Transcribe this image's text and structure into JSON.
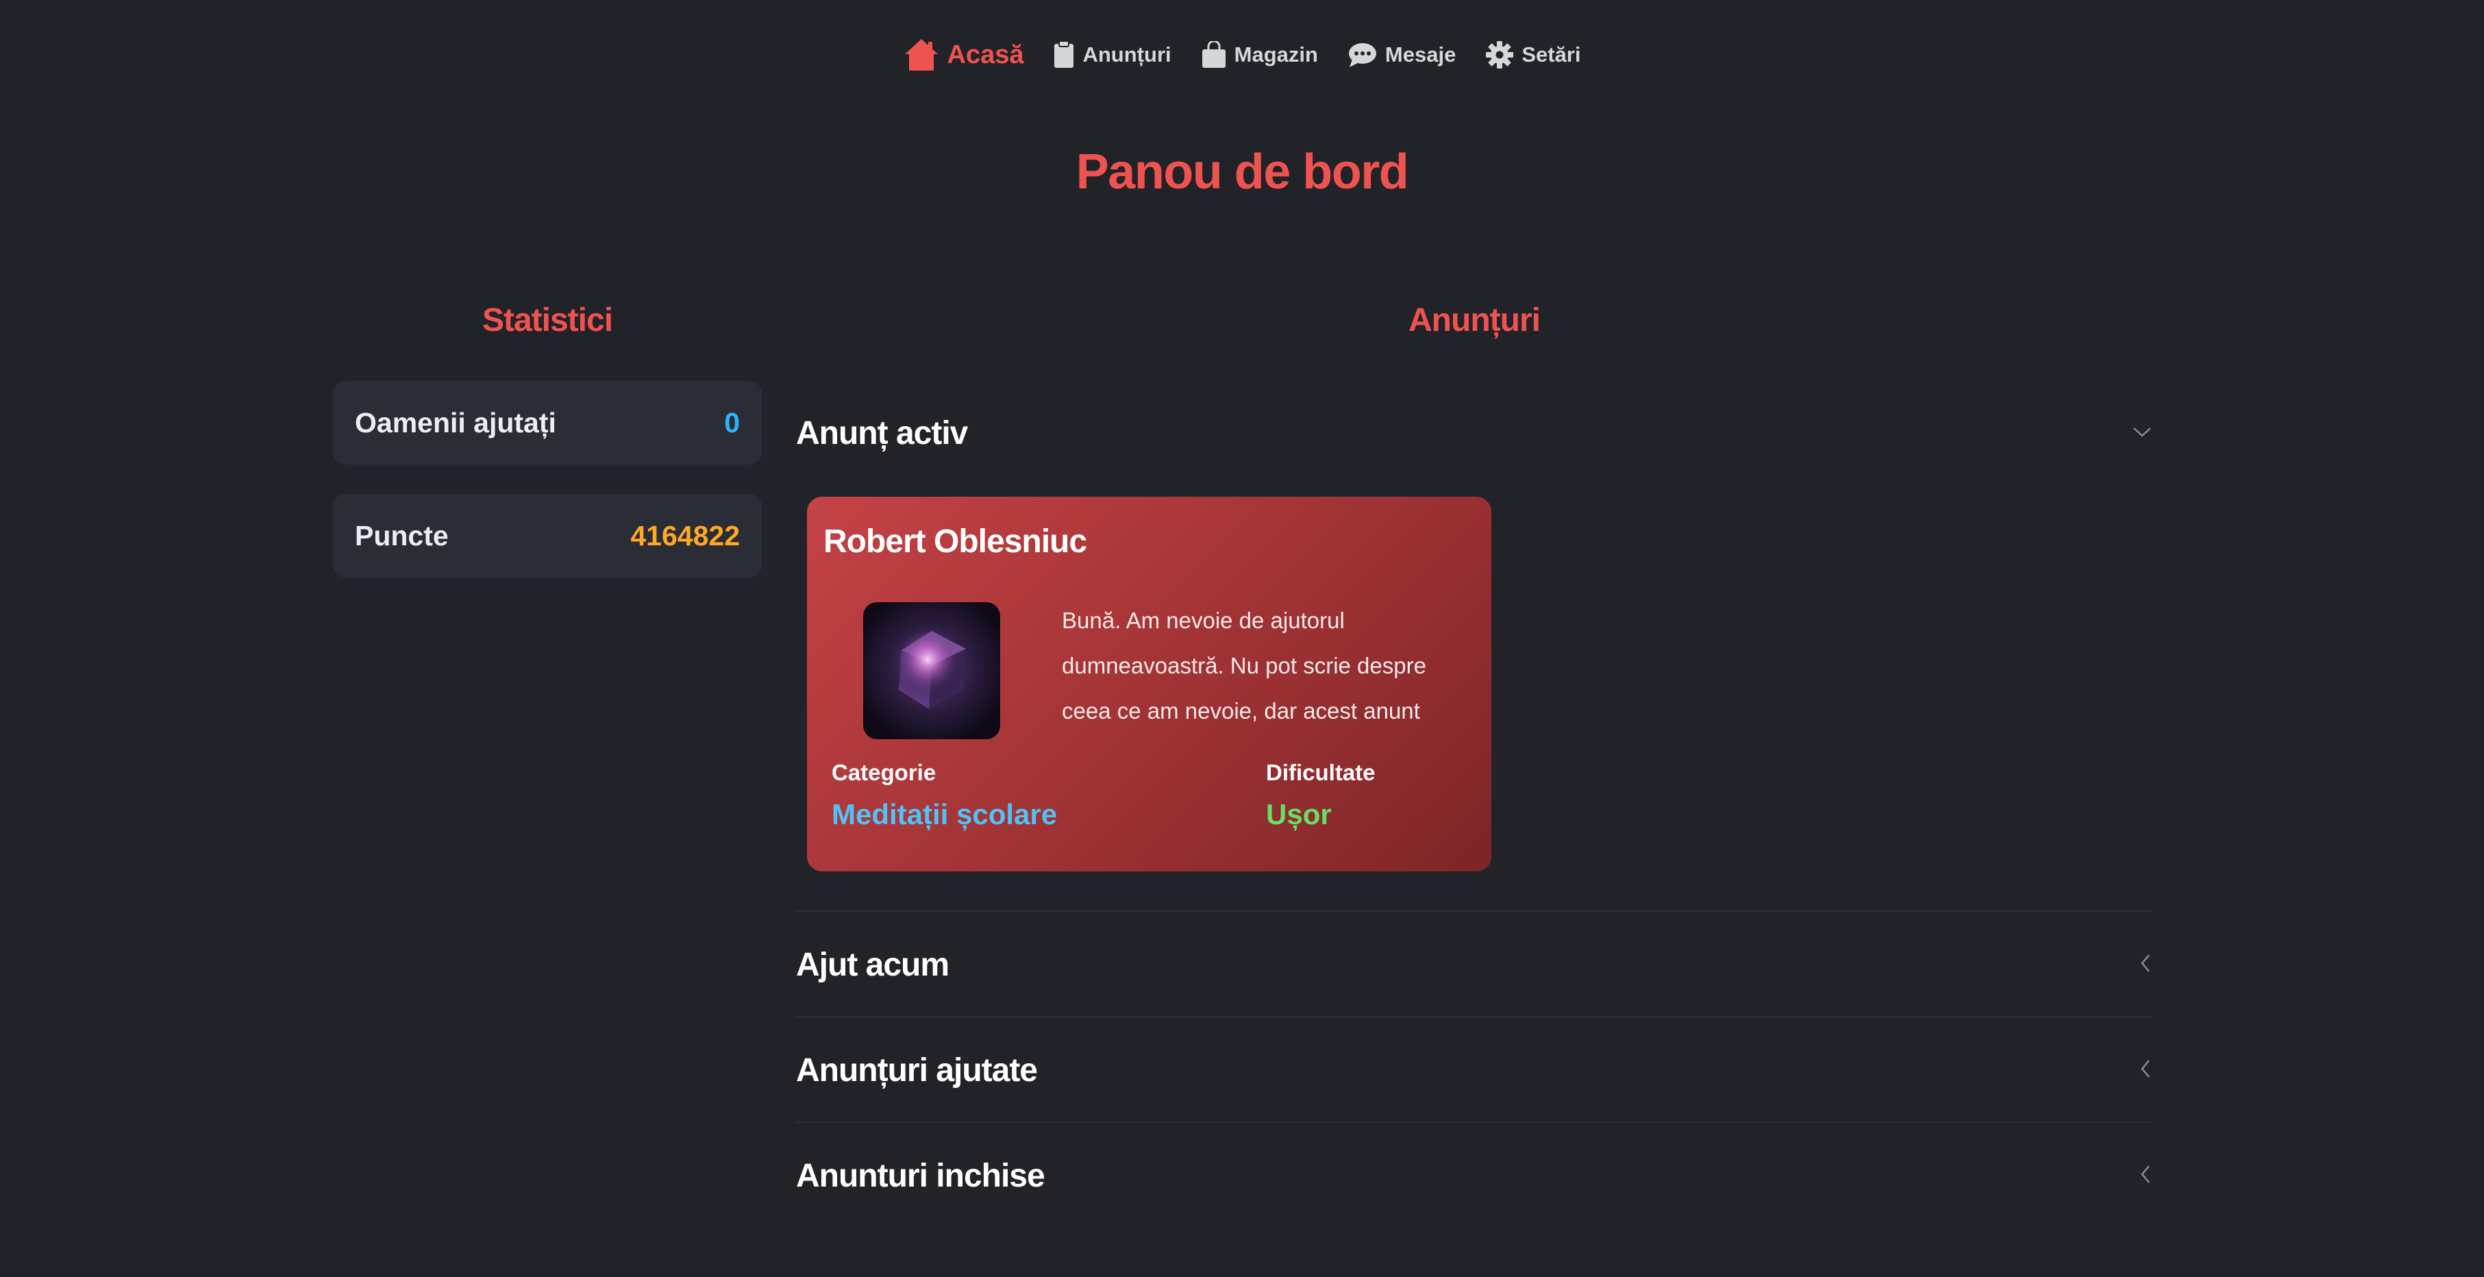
{
  "nav": {
    "items": [
      {
        "label": "Acasă",
        "icon": "home-icon",
        "active": true
      },
      {
        "label": "Anunțuri",
        "icon": "clipboard-icon"
      },
      {
        "label": "Magazin",
        "icon": "shopping-bag-icon"
      },
      {
        "label": "Mesaje",
        "icon": "chat-icon"
      },
      {
        "label": "Setări",
        "icon": "gear-icon"
      }
    ]
  },
  "page_title": "Panou de bord",
  "stats": {
    "title": "Statistici",
    "items": [
      {
        "label": "Oamenii ajutați",
        "value": "0",
        "color": "#29b6f6"
      },
      {
        "label": "Puncte",
        "value": "4164822",
        "color": "#ffa726"
      }
    ]
  },
  "announcements": {
    "title": "Anunțuri",
    "sections": [
      {
        "title": "Anunț activ",
        "expanded": true
      },
      {
        "title": "Ajut acum",
        "expanded": false
      },
      {
        "title": "Anunțuri ajutate",
        "expanded": false
      },
      {
        "title": "Anunturi inchise",
        "expanded": false
      }
    ],
    "active_card": {
      "name": "Robert Oblesniuc",
      "text": "Bună. Am nevoie de ajutorul dumneavoastră. Nu pot scrie despre ceea ce am nevoie, dar acest anunt",
      "category_label": "Categorie",
      "category_value": "Meditații școlare",
      "category_color": "#4fc3f7",
      "difficulty_label": "Dificultate",
      "difficulty_value": "Ușor",
      "difficulty_color": "#66e066"
    }
  },
  "colors": {
    "background": "#212329",
    "accent": "#ef5350",
    "card": "#b23b3e"
  }
}
